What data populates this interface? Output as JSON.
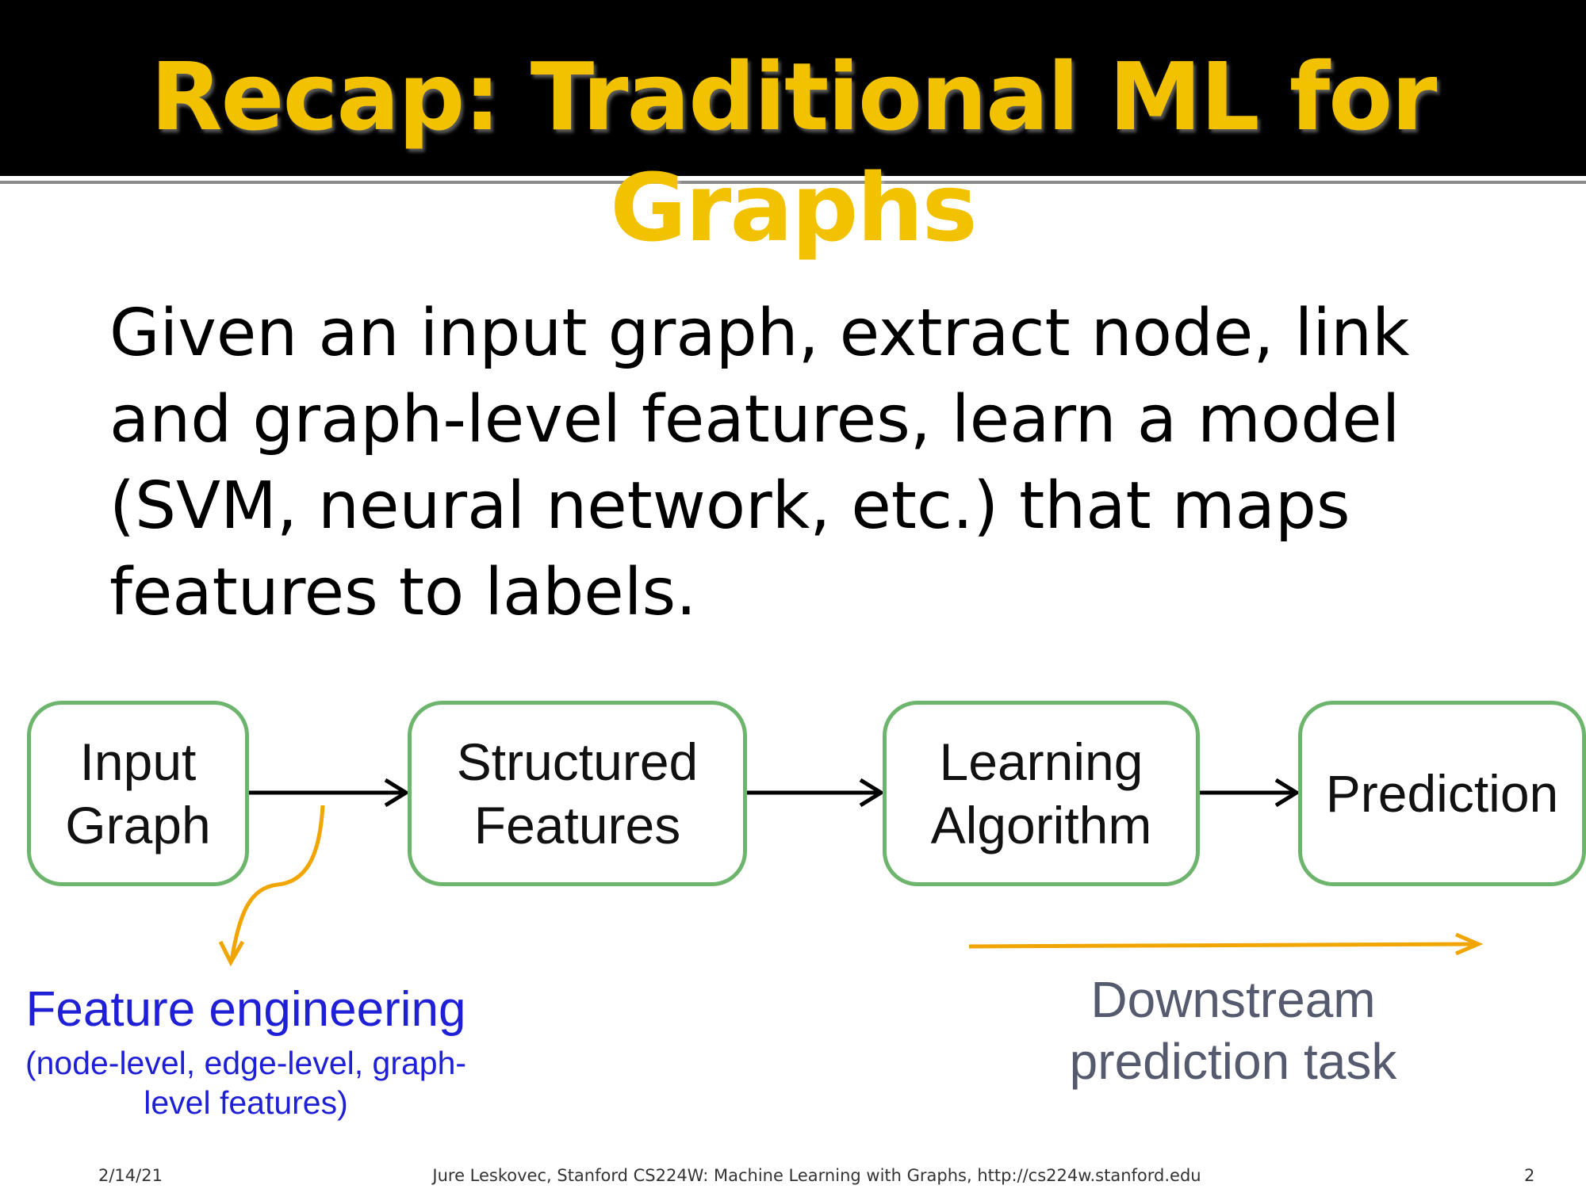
{
  "title": "Recap: Traditional ML for Graphs",
  "body": {
    "lines": [
      "Given an input graph, extract node, link",
      "and graph-level features, learn a model",
      "(SVM, neural network, etc.) that maps",
      "features to labels."
    ]
  },
  "pipeline": {
    "input": {
      "line1": "Input",
      "line2": "Graph"
    },
    "features": {
      "line1": "Structured",
      "line2": "Features"
    },
    "learning": {
      "line1": "Learning",
      "line2": "Algorithm"
    },
    "prediction": {
      "line1": "Prediction"
    }
  },
  "feature_engineering": {
    "title": "Feature engineering",
    "subtitle_line1": "(node-level, edge-level, graph-",
    "subtitle_line2": "level features)"
  },
  "downstream": {
    "line1": "Downstream",
    "line2": "prediction task"
  },
  "footer": {
    "date": "2/14/21",
    "credit": "Jure Leskovec, Stanford CS224W: Machine Learning with Graphs, http://cs224w.stanford.edu",
    "page": "2"
  },
  "colors": {
    "title": "#f2c200",
    "box_border": "#6db56c",
    "orange_arrow": "#f0a500",
    "feature_text": "#1f1fd6",
    "downstream_text": "#555a6e"
  }
}
